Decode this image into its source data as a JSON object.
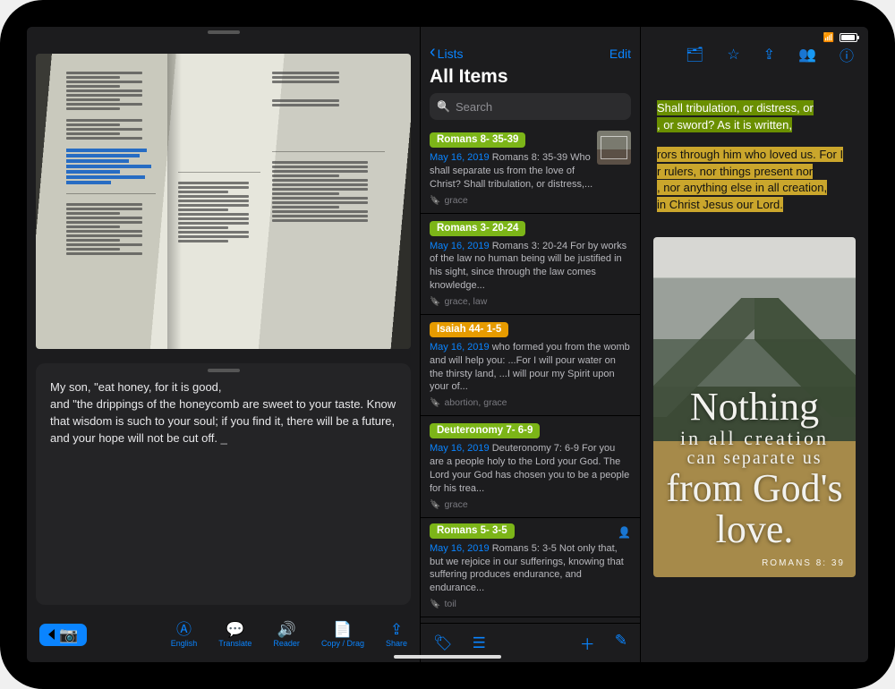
{
  "status": {
    "battery": 85
  },
  "left": {
    "note_line1": "My son, \"eat honey, for it is good,",
    "note_line2": "and \"the drippings of the honeycomb are sweet to your taste. Know that wisdom is such to your soul; if you find it, there will be a future, and your hope will not be cut off. ",
    "toolbar": {
      "english": "English",
      "translate": "Translate",
      "reader": "Reader",
      "copy": "Copy / Drag",
      "share": "Share"
    }
  },
  "mid": {
    "back_label": "Lists",
    "edit_label": "Edit",
    "title": "All Items",
    "search_placeholder": "Search",
    "items": [
      {
        "chip": "Romans 8- 35-39",
        "chip_color": "green",
        "date": "May 16, 2019",
        "excerpt": "Romans 8: 35-39 Who shall separate us from the love of Christ? Shall tribulation, or distress,...",
        "tags": "grace",
        "has_thumb": true
      },
      {
        "chip": "Romans 3- 20-24",
        "chip_color": "green",
        "date": "May 16, 2019",
        "excerpt": "Romans 3: 20-24 For by works of the law no human being will be justified in his sight, since through the law comes knowledge...",
        "tags": "grace, law"
      },
      {
        "chip": "Isaiah 44- 1-5",
        "chip_color": "orange",
        "date": "May 16, 2019",
        "excerpt": "who formed you from the womb and will help you: ...For I will pour water on the thirsty land, ...I will pour my Spirit upon your of...",
        "tags": "abortion, grace"
      },
      {
        "chip": "Deuteronomy 7- 6-9",
        "chip_color": "green",
        "date": "May 16, 2019",
        "excerpt": "Deuteronomy 7: 6-9 For you are a people holy to the Lord your God. The Lord your God has chosen you to be a people for his trea...",
        "tags": "grace"
      },
      {
        "chip": "Romans 5- 3-5",
        "chip_color": "green",
        "date": "May 16, 2019",
        "excerpt": "Romans 5: 3-5 Not only that, but we rejoice in our sufferings, knowing that suffering produces endurance, and endurance...",
        "tags": "toil",
        "has_avatar": true
      }
    ]
  },
  "right": {
    "frag1": "Shall tribulation, or distress, or",
    "frag2": ", or sword? As it is written,",
    "frag3a": "rors through him who loved us. For I",
    "frag3b": "r rulers, nor things present nor",
    "frag3c": ", nor anything else in all creation,",
    "frag3d": "in Christ Jesus our Lord.",
    "quote_l1": "Nothing",
    "quote_l2": "in all creation",
    "quote_l3": "can separate us",
    "quote_l4": "from God's love.",
    "credit": "ROMANS 8: 39"
  }
}
